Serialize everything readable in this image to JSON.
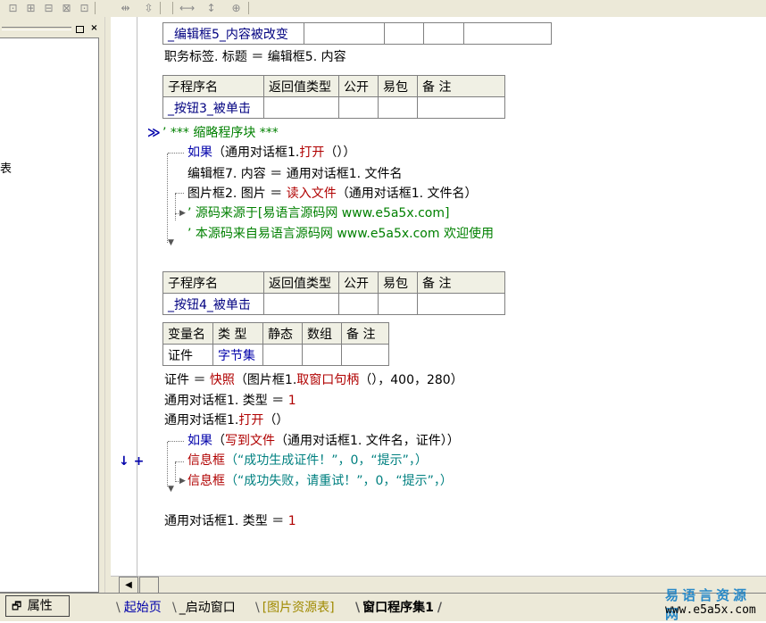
{
  "left_panel": {
    "cut_text": "表"
  },
  "bottom": {
    "properties_tab": "属性",
    "tabs": [
      "起始页",
      "_启动窗口",
      "[图片资源表]",
      "窗口程序集1"
    ],
    "logo_cn": "易语言资源网",
    "logo_url": "www.e5a5x.com"
  },
  "code": {
    "top_table_cell": "_编辑框5_内容被改变",
    "line_title_assign": "职务标签. 标题 ＝ 编辑框5. 内容",
    "sub_headers": [
      "子程序名",
      "返回值类型",
      "公开",
      "易包",
      "备 注"
    ],
    "sub1_name": "_按钮3_被单击",
    "collapse_marker": "≫",
    "comment_block": "’ *** 缩略程序块 ***",
    "if1_kw": "如果",
    "if1_rest": "（通用对话框1.",
    "if1_open": "打开",
    "if1_end": "（））",
    "line_edit7": "编辑框7. 内容 ＝ 通用对话框1. 文件名",
    "line_pic_a": "图片框2. 图片 ＝ ",
    "line_pic_fn": "读入文件",
    "line_pic_b": "（通用对话框1. 文件名）",
    "comment1": "’ 源码来源于[易语言源码网 www.e5a5x.com]",
    "comment2": "’ 本源码来自易语言源码网 www.e5a5x.com  欢迎使用",
    "sub2_name": "_按钮4_被单击",
    "var_headers": [
      "变量名",
      "类 型",
      "静态",
      "数组",
      "备 注"
    ],
    "var_name": "证件",
    "var_type": "字节集",
    "line_snap_a": "证件 ＝ ",
    "line_snap_fn": "快照",
    "line_snap_b": "（图片框1.",
    "line_snap_fn2": "取窗口句柄",
    "line_snap_c": "（），400，280）",
    "line_type_a": "通用对话框1. 类型 ＝ ",
    "line_type_val": "1",
    "line_open_a": "通用对话框1.",
    "line_open_fn": "打开",
    "line_open_b": "（）",
    "if2_kw": "如果",
    "if2_a": "（",
    "if2_fn": "写到文件",
    "if2_b": "（通用对话框1. 文件名，证件））",
    "msg_fn": "信息框",
    "msg1_args": "（“成功生成证件！”，0，“提示”，）",
    "msg2_args": "（“成功失败，请重试！”，0，“提示”，）",
    "gutter_marks": "↓ +",
    "line_type2_a": "通用对话框1. 类型 ＝ ",
    "line_type2_val": "1"
  }
}
